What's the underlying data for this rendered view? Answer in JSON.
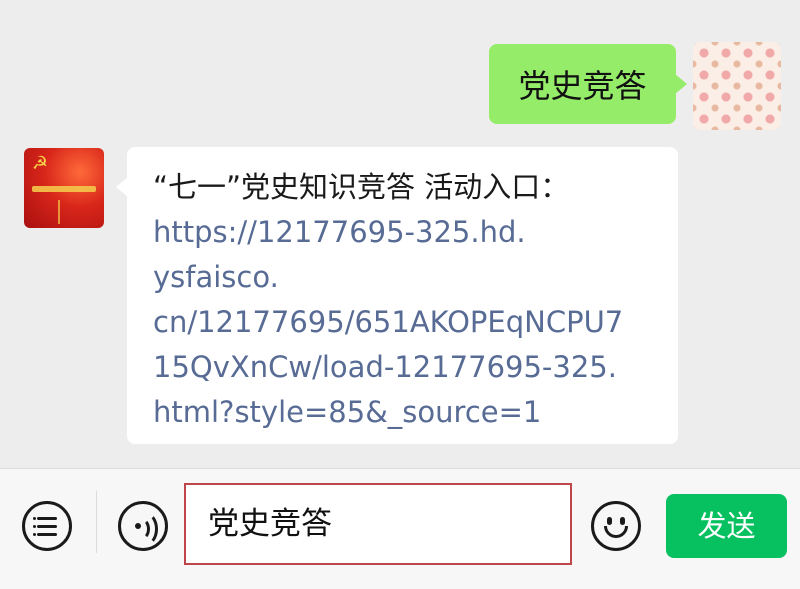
{
  "messages": {
    "outgoing": {
      "text": "党史竞答"
    },
    "incoming": {
      "intro": "“七一”党史知识竞答  活动入口：",
      "link_lines": [
        "https://12177695-325.hd.",
        "ysfaisco.",
        "cn/12177695/651AKOPEqNCPU7",
        "15QvXnCw/load-12177695-325.",
        "html?style=85&_source=1"
      ]
    }
  },
  "input_bar": {
    "input_value": "党史竞答",
    "send_label": "发送"
  },
  "icons": {
    "menu": "menu-icon",
    "voice": "voice-icon",
    "emoji": "emoji-icon"
  },
  "colors": {
    "outgoing_bubble": "#95ec69",
    "link": "#576b95",
    "send_button": "#07c160",
    "input_border": "#c0454b"
  }
}
